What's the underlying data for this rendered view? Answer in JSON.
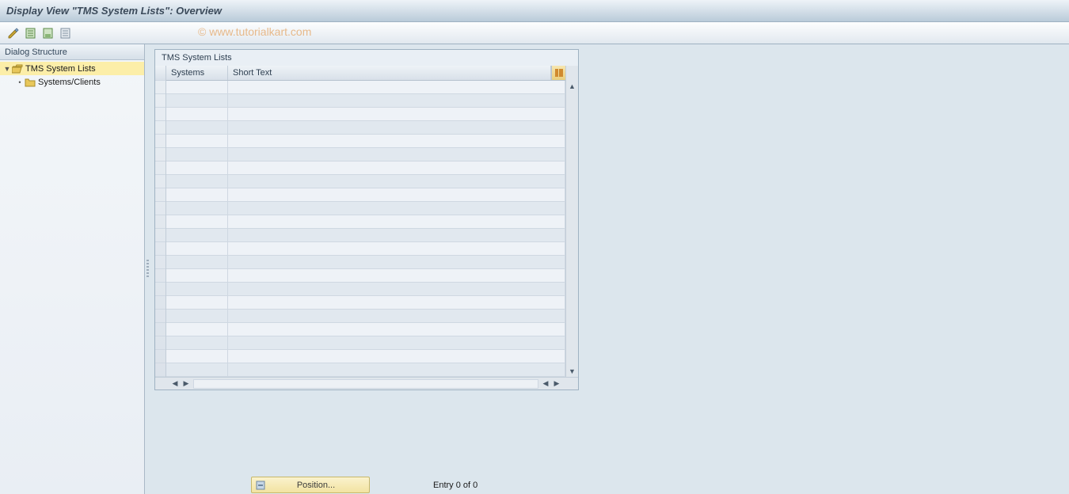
{
  "titlebar": {
    "text": "Display View \"TMS System Lists\": Overview"
  },
  "toolbar": {
    "icons": [
      "change-icon",
      "select-all-icon",
      "save-icon",
      "print-icon"
    ]
  },
  "watermark": "© www.tutorialkart.com",
  "tree": {
    "header": "Dialog Structure",
    "nodes": [
      {
        "label": "TMS System Lists",
        "selected": true,
        "expandable": true,
        "indent": 0,
        "icon": "folder-open"
      },
      {
        "label": "Systems/Clients",
        "selected": false,
        "expandable": false,
        "indent": 1,
        "icon": "folder-closed"
      }
    ]
  },
  "grid": {
    "title": "TMS System Lists",
    "columns": {
      "systems": "Systems",
      "shorttext": "Short Text"
    },
    "row_count": 22,
    "rows": []
  },
  "footer": {
    "position_label": "Position...",
    "entry_text": "Entry 0 of 0"
  }
}
